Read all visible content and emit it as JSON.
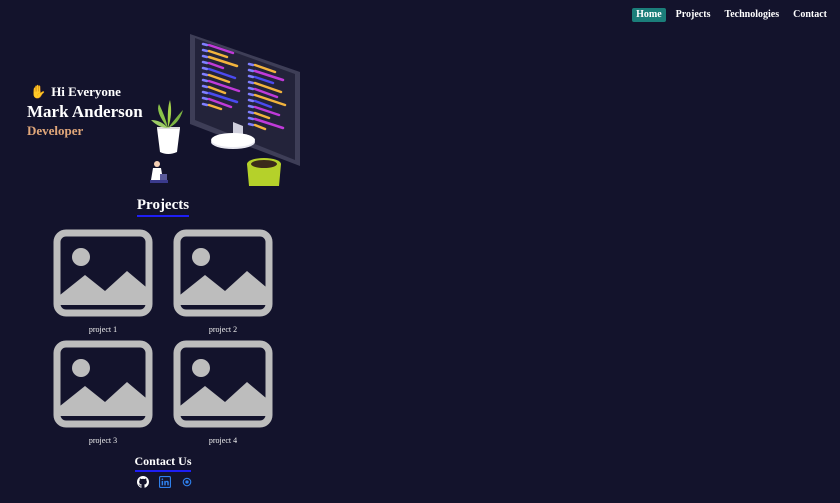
{
  "nav": {
    "items": [
      {
        "label": "Home",
        "active": true
      },
      {
        "label": "Projects",
        "active": false
      },
      {
        "label": "Technologies",
        "active": false
      },
      {
        "label": "Contact",
        "active": false
      }
    ]
  },
  "hero": {
    "greeting_icon": "waving-hand-icon",
    "greeting": "Hi Everyone",
    "name": "Mark Anderson",
    "role": "Developer",
    "illustration": "developer-workspace-illustration"
  },
  "projects": {
    "title": "Projects",
    "items": [
      {
        "label": "project 1",
        "icon": "image-placeholder-icon"
      },
      {
        "label": "project 2",
        "icon": "image-placeholder-icon"
      },
      {
        "label": "project 3",
        "icon": "image-placeholder-icon"
      },
      {
        "label": "project 4",
        "icon": "image-placeholder-icon"
      }
    ]
  },
  "contact": {
    "title": "Contact Us",
    "links": [
      {
        "icon": "github-icon"
      },
      {
        "icon": "linkedin-icon"
      },
      {
        "icon": "website-icon"
      }
    ]
  },
  "colors": {
    "background": "#13132c",
    "nav_active": "#1b7e7a",
    "accent_underline": "#1e1ef5",
    "role_text": "#e1a77a",
    "placeholder": "#bdbdbd"
  }
}
